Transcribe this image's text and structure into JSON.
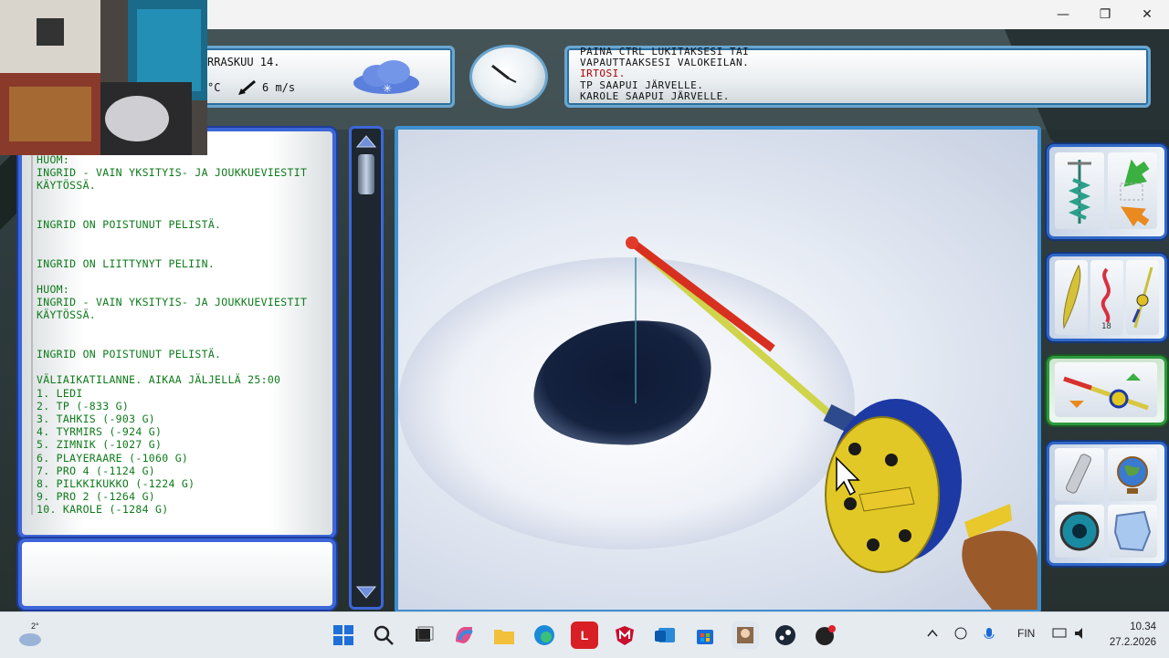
{
  "window": {
    "minimize_glyph": "—",
    "restore_glyph": "❐",
    "close_glyph": "✕"
  },
  "weather": {
    "date_text": "RRASKUU 14.",
    "temp_unit": "°C",
    "wind_speed": "6 m/s",
    "wind_arrow_icon": "wind-direction-arrow-icon",
    "cloud_icon": "snow-cloud-icon"
  },
  "messages": [
    "PAINA CTRL LUKITAKSESI TAI",
    "VAPAUTTAAKSESI VALOKEILAN.",
    "IRTOSI.",
    "TP SAAPUI JÄRVELLE.",
    "KAROLE SAAPUI JÄRVELLE."
  ],
  "chat": [
    "HUOM:",
    "INGRID - VAIN YKSITYIS- JA JOUKKUEVIESTIT",
    "KÄYTÖSSÄ.",
    "",
    "",
    "INGRID ON POISTUNUT PELISTÄ.",
    "",
    "",
    "INGRID ON LIITTYNYT PELIIN.",
    "",
    "HUOM:",
    "INGRID - VAIN YKSITYIS- JA JOUKKUEVIESTIT",
    "KÄYTÖSSÄ.",
    "",
    "",
    "INGRID ON POISTUNUT PELISTÄ.",
    "",
    "VÄLIAIKATILANNE. AIKAA JÄLJELLÄ 25:00",
    "1. LEDI",
    "2. TP (-833 G)",
    "3. TAHKIS (-903 G)",
    "4. TYRMIRS (-924 G)",
    "5. ZIMNIK (-1027 G)",
    "6. PLAYERAARE (-1060 G)",
    "7. PRO 4 (-1124 G)",
    "8. PILKKIKUKKO (-1224 G)",
    "9. PRO 2 (-1264 G)",
    "10. KAROLE (-1284 G)"
  ],
  "chat_input": {
    "value": ""
  },
  "tools": {
    "tool_badge_count": "18"
  },
  "taskbar": {
    "weather_temp": "2°",
    "language": "FIN",
    "time": "10.34",
    "date": "27.2.2026"
  }
}
